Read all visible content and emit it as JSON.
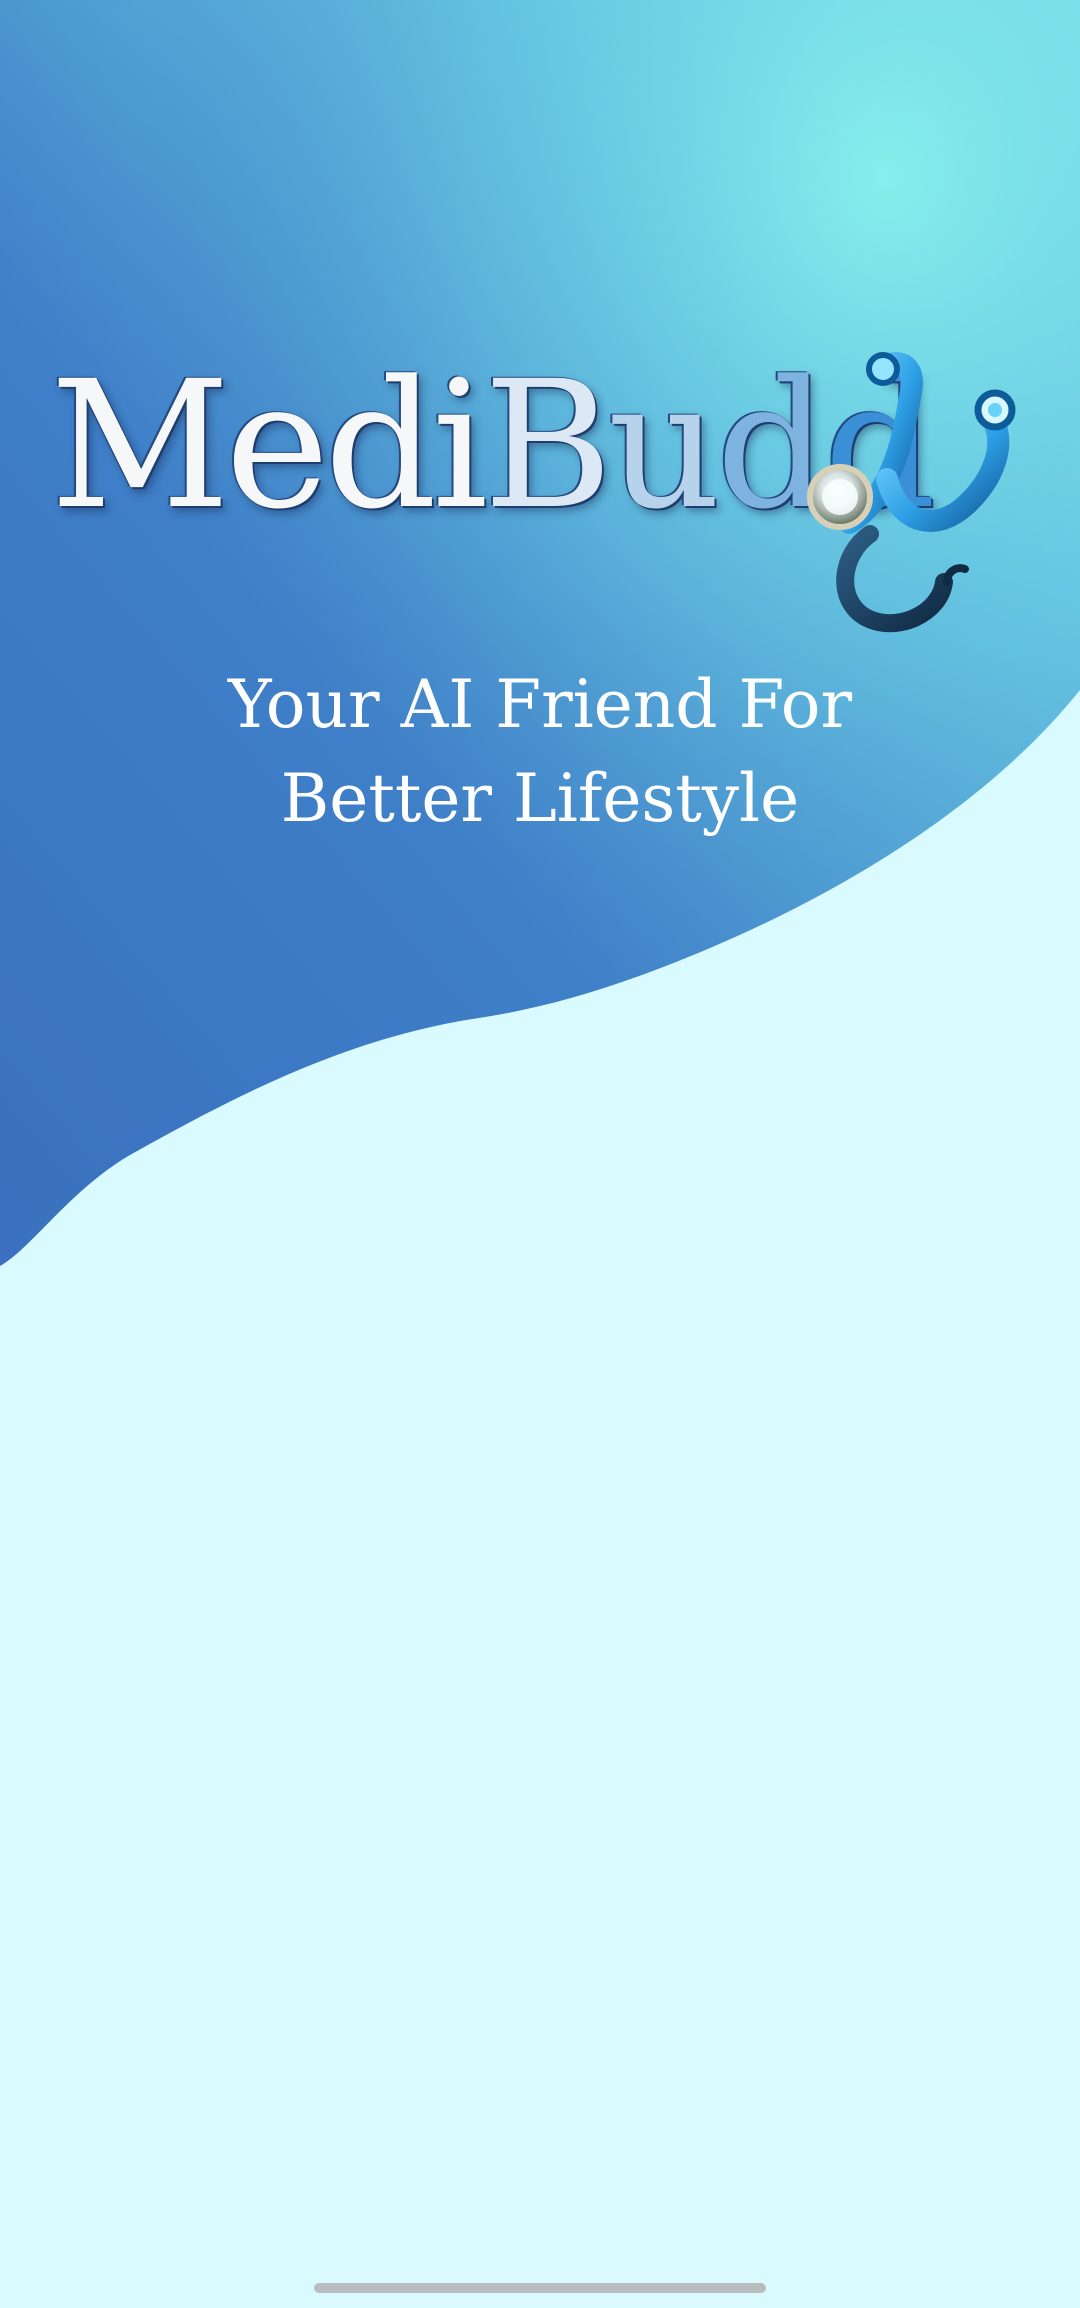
{
  "app": {
    "brand": {
      "logo_text": "MediBuddy",
      "logo_parts": {
        "main": "Medi",
        "b": "B",
        "u": "u",
        "d1": "d",
        "d2": "d"
      },
      "logo_icon": "stethoscope-icon"
    },
    "tagline": {
      "line1": "Your AI Friend For",
      "line2": "Better Lifestyle"
    }
  },
  "theme": {
    "background": "#d9fbff",
    "wave_dark": "#3c78c4",
    "wave_light": "#82e8ea",
    "text": "#ffffff",
    "accent": "#2f8fd6"
  },
  "system": {
    "home_indicator": "home-indicator"
  }
}
